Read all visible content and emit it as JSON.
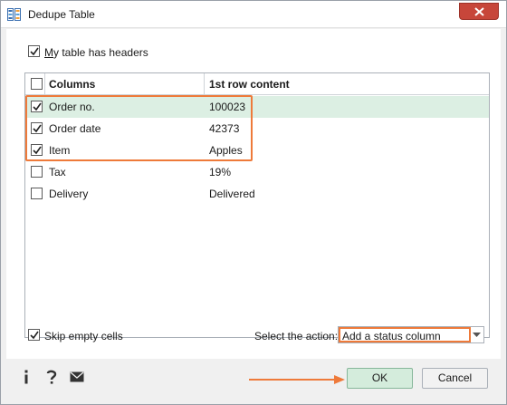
{
  "window": {
    "title": "Dedupe Table",
    "close_icon": "close-icon",
    "app_icon": "dedupe-table-icon",
    "accent_color": "#ee7a3a",
    "selected_row_color": "#dcefe3"
  },
  "options": {
    "headers_checkbox": {
      "label": "My table has headers",
      "mnemonic": "M",
      "label_rest": "y table has headers",
      "checked": true
    },
    "skip_empty_checkbox": {
      "label": "Skip empty cells",
      "checked": true
    }
  },
  "table": {
    "columns": [
      "Columns",
      "1st row content"
    ],
    "select_all_checked": false,
    "rows": [
      {
        "name": "Order no.",
        "content": "100023",
        "checked": true,
        "selected": true
      },
      {
        "name": "Order date",
        "content": "42373",
        "checked": true,
        "selected": false
      },
      {
        "name": "Item",
        "content": "Apples",
        "checked": true,
        "selected": false
      },
      {
        "name": "Tax",
        "content": "19%",
        "checked": false,
        "selected": false
      },
      {
        "name": "Delivery",
        "content": "Delivered",
        "checked": false,
        "selected": false
      }
    ]
  },
  "action": {
    "label": "Select the action:",
    "value": "Add a status column"
  },
  "footer": {
    "icons": [
      "info-icon",
      "help-icon",
      "mail-icon"
    ],
    "ok_label": "OK",
    "cancel_label": "Cancel"
  }
}
